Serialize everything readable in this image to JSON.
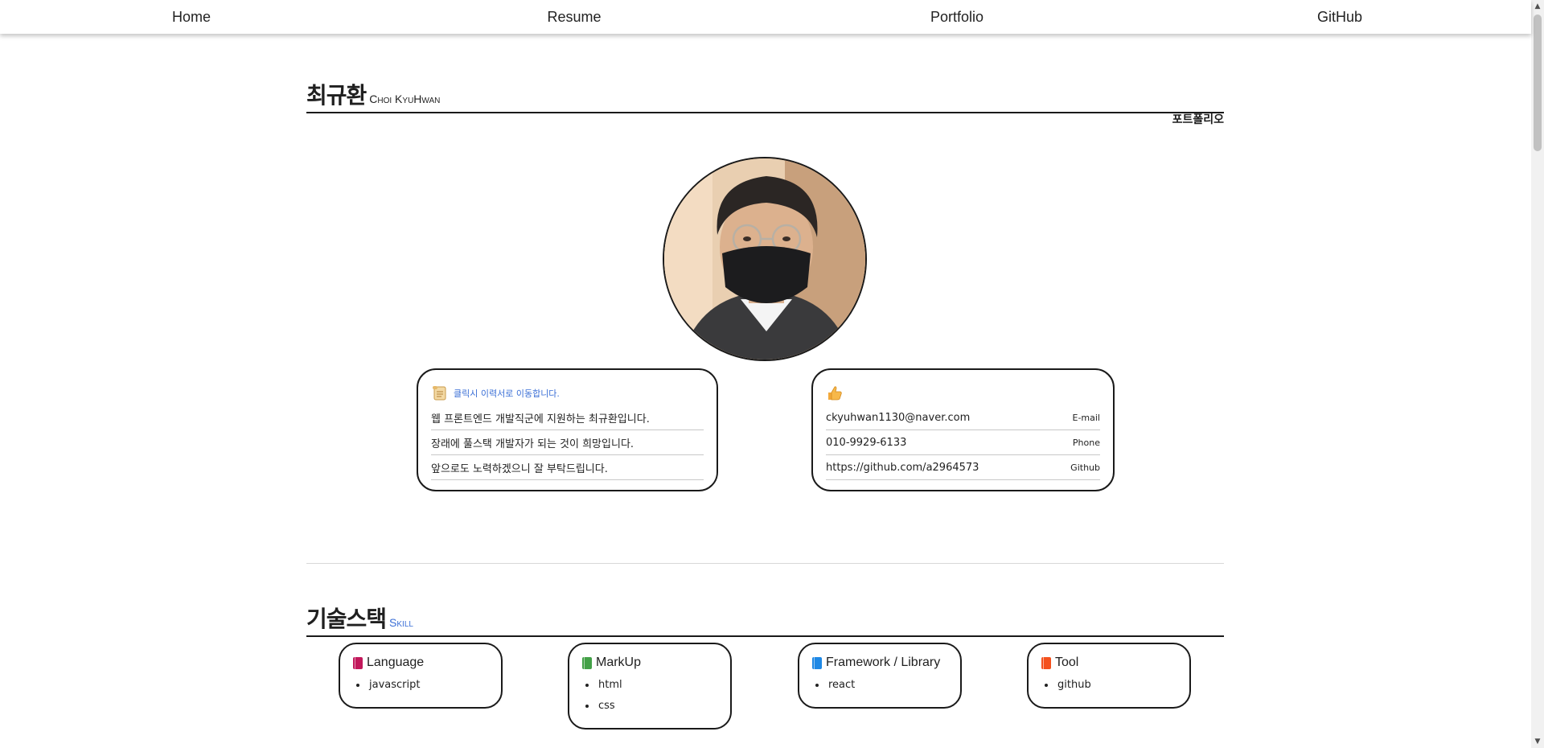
{
  "nav": {
    "items": [
      {
        "label": "Home"
      },
      {
        "label": "Resume"
      },
      {
        "label": "Portfolio"
      },
      {
        "label": "GitHub"
      }
    ]
  },
  "profile": {
    "name_ko": "최규환",
    "name_en": "Choi KyuHwan",
    "portfolio_link": "포트폴리오",
    "avatar_icon": "person-photo"
  },
  "intro_card": {
    "icon": "scroll-icon",
    "link_text": "클릭시 이력서로 이동합니다.",
    "lines": [
      "웹 프론트엔드 개발직군에 지원하는 최규환입니다.",
      "장래에 풀스택 개발자가 되는 것이 희망입니다.",
      "앞으로도 노력하겠으니 잘 부탁드립니다."
    ]
  },
  "contact_card": {
    "icon": "thumbs-up-icon",
    "rows": [
      {
        "value": "ckyuhwan1130@naver.com",
        "label": "E-mail"
      },
      {
        "value": "010-9929-6133",
        "label": "Phone"
      },
      {
        "value": "https://github.com/a2964573",
        "label": "Github"
      }
    ]
  },
  "skills": {
    "title_ko": "기술스택",
    "title_en": "Skill",
    "groups": [
      {
        "title": "Language",
        "color": "#c2185b",
        "items": [
          "javascript"
        ]
      },
      {
        "title": "MarkUp",
        "color": "#43a047",
        "items": [
          "html",
          "css"
        ]
      },
      {
        "title": "Framework / Library",
        "color": "#1e88e5",
        "items": [
          "react"
        ]
      },
      {
        "title": "Tool",
        "color": "#f4511e",
        "items": [
          "github"
        ]
      }
    ]
  },
  "colors": {
    "accent": "#3b6fd6",
    "border": "#1a1a1a"
  }
}
